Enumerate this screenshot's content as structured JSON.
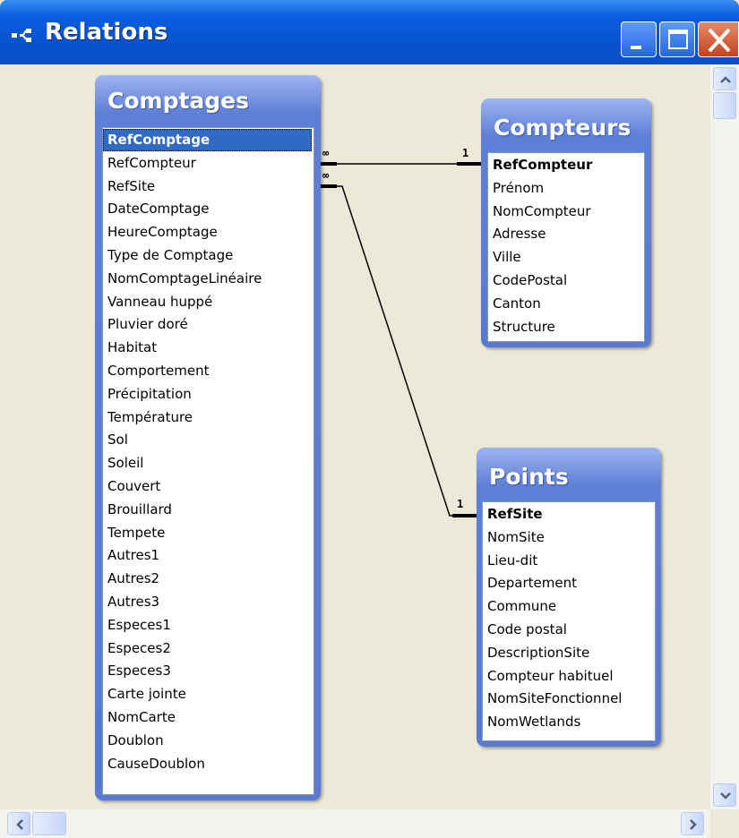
{
  "window": {
    "title": "Relations"
  },
  "tables": {
    "comptages": {
      "title": "Comptages",
      "fields": [
        "RefComptage",
        "RefCompteur",
        "RefSite",
        "DateComptage",
        "HeureComptage",
        "Type de Comptage",
        "NomComptageLinéaire",
        "Vanneau huppé",
        "Pluvier doré",
        "Habitat",
        "Comportement",
        "Précipitation",
        "Température",
        "Sol",
        "Soleil",
        "Couvert",
        "Brouillard",
        "Tempete",
        "Autres1",
        "Autres2",
        "Autres3",
        "Especes1",
        "Especes2",
        "Especes3",
        "Carte jointe",
        "NomCarte",
        "Doublon",
        "CauseDoublon"
      ],
      "selected_field": "RefComptage"
    },
    "compteurs": {
      "title": "Compteurs",
      "fields": [
        "RefCompteur",
        "Prénom",
        "NomCompteur",
        "Adresse",
        "Ville",
        "CodePostal",
        "Canton",
        "Structure"
      ],
      "key_field": "RefCompteur"
    },
    "points": {
      "title": "Points",
      "fields": [
        "RefSite",
        "NomSite",
        "Lieu-dit",
        "Departement",
        "Commune",
        "Code postal",
        "DescriptionSite",
        "Compteur habituel",
        "NomSiteFonctionnel",
        "NomWetlands"
      ],
      "key_field": "RefSite"
    }
  },
  "relationships": [
    {
      "from": "Comptages.RefCompteur",
      "to": "Compteurs.RefCompteur",
      "many_label": "∞",
      "one_label": "1"
    },
    {
      "from": "Comptages.RefSite",
      "to": "Points.RefSite",
      "many_label": "∞",
      "one_label": "1"
    }
  ],
  "colors": {
    "titlebar": "#0A5EE0",
    "table_header": "#5F7FD6",
    "selection": "#316AC5",
    "workspace": "#ECE9D8"
  }
}
